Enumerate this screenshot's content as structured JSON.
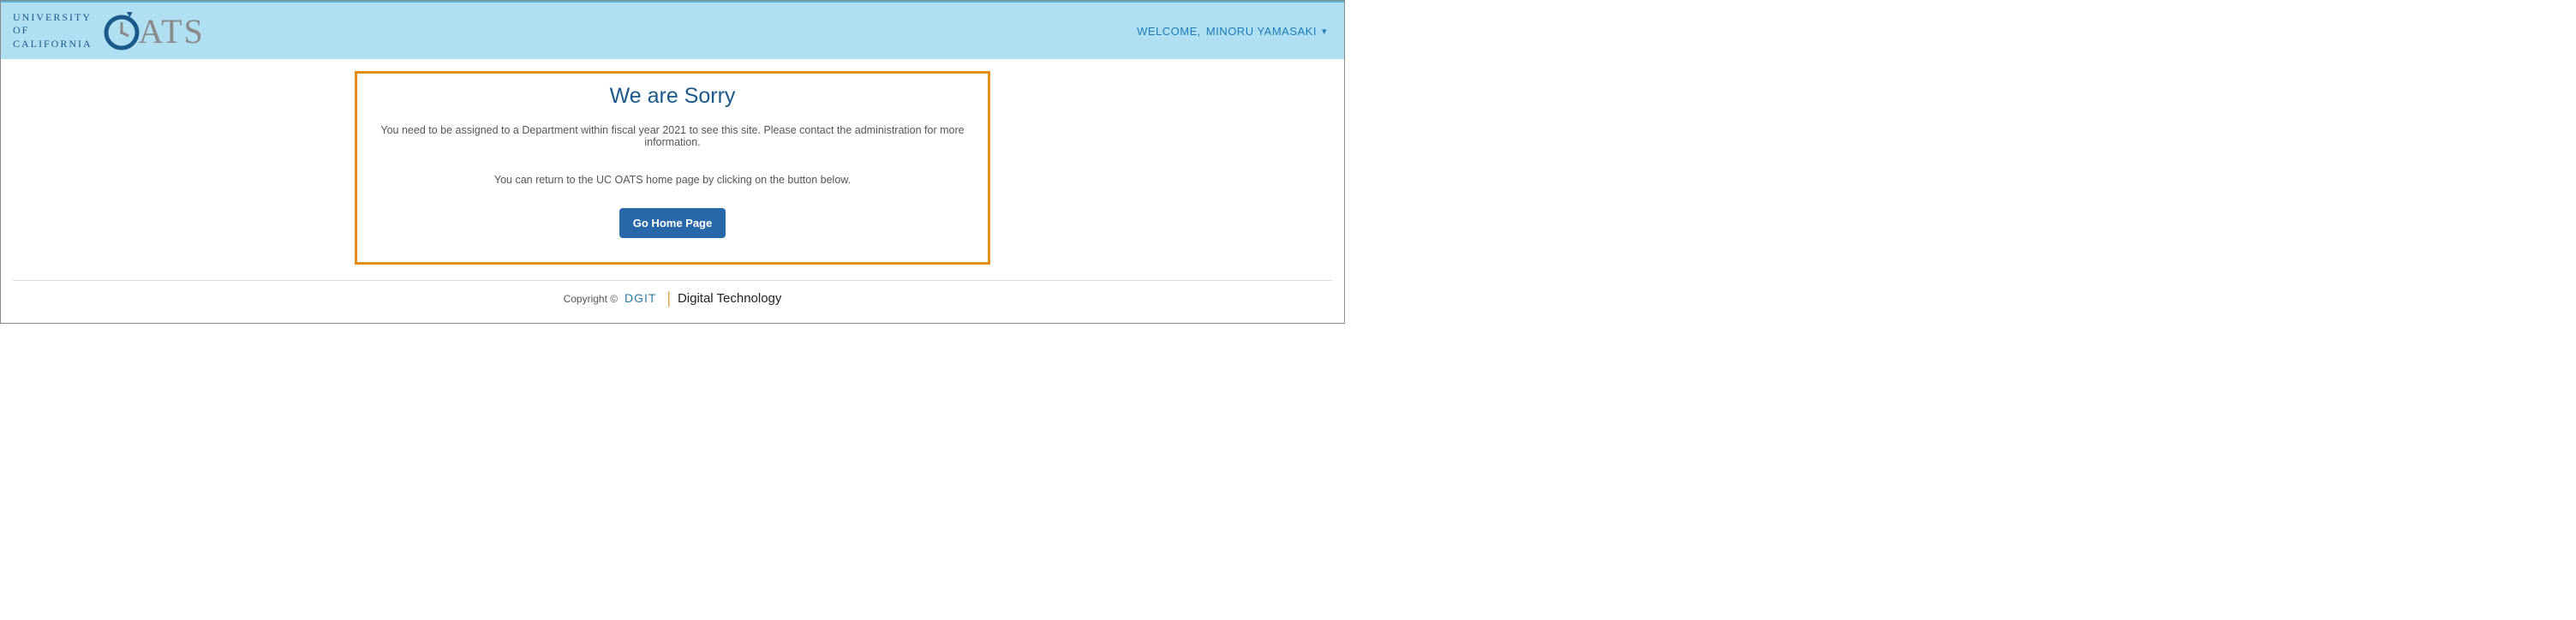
{
  "header": {
    "org_line1": "UNIVERSITY",
    "org_line2": "OF",
    "org_line3": "CALIFORNIA",
    "app_name": "ATS",
    "welcome_prefix": "WELCOME,",
    "user_name": "MINORU YAMASAKI"
  },
  "main": {
    "title": "We are Sorry",
    "message1": "You need to be assigned to a Department within fiscal year 2021 to see this site. Please contact the administration for more information.",
    "message2": "You can return to the UC OATS home page by clicking on the button below.",
    "button_label": "Go Home Page"
  },
  "footer": {
    "copyright": "Copyright ©",
    "dgit": "DGIT",
    "digtech": "Digital Technology"
  }
}
